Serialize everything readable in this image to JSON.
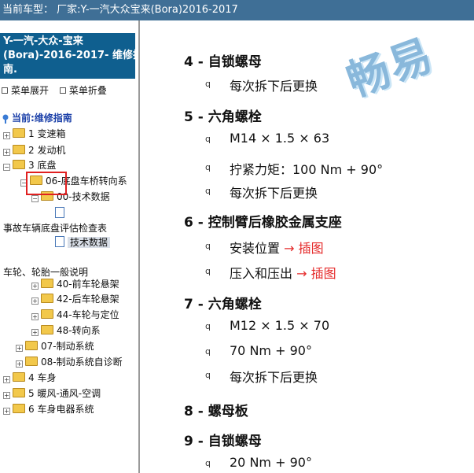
{
  "title": "当前车型：  厂家:Y-一汽大众宝来(Bora)2016-2017",
  "sidebar": {
    "header_lines": [
      "Y-一汽-大众-宝来",
      "(Bora)-2016-2017- 维修指",
      "南."
    ],
    "expand_label": "菜单展开",
    "collapse_label": "菜单折叠",
    "current_label": "当前:维修指南",
    "tree": [
      {
        "label": "1 变速箱",
        "type": "folder",
        "expander": "+"
      },
      {
        "label": "2 发动机",
        "type": "folder",
        "expander": "+"
      },
      {
        "label": "3 底盘",
        "type": "folder",
        "expander": "-",
        "highlighted": true
      },
      {
        "label": "06-底盘车桥转向系",
        "type": "folder",
        "expander": "-"
      },
      {
        "label": "00-技术数据",
        "type": "folder",
        "expander": "-"
      },
      {
        "label": "",
        "type": "doc"
      },
      {
        "label": "事故车辆底盘评估检查表",
        "type": "text"
      },
      {
        "label": "技术数据",
        "type": "doc",
        "selected": true
      },
      {
        "label": "车轮、轮胎一般说明",
        "type": "text"
      },
      {
        "label": "40-前车轮悬架",
        "type": "folder",
        "expander": "+"
      },
      {
        "label": "42-后车轮悬架",
        "type": "folder",
        "expander": "+"
      },
      {
        "label": "44-车轮与定位",
        "type": "folder",
        "expander": "+"
      },
      {
        "label": "48-转向系",
        "type": "folder",
        "expander": "+"
      },
      {
        "label": "07-制动系统",
        "type": "folder",
        "expander": "+"
      },
      {
        "label": "08-制动系统自诊断",
        "type": "folder",
        "expander": "+"
      },
      {
        "label": "4 车身",
        "type": "folder",
        "expander": "+"
      },
      {
        "label": "5 暖风-通风-空调",
        "type": "folder",
        "expander": "+"
      },
      {
        "label": "6 车身电器系统",
        "type": "folder",
        "expander": "+"
      }
    ]
  },
  "content": {
    "watermark": "畅易",
    "bullet_char": "q",
    "sections": [
      {
        "heading": "4 - 自锁螺母",
        "items": [
          {
            "text": "每次拆下后更换"
          }
        ]
      },
      {
        "heading": "5 - 六角螺栓",
        "items": [
          {
            "text": "M14 × 1.5 × 63"
          },
          {
            "text": "拧紧力矩：100 Nm + 90°"
          },
          {
            "text": "每次拆下后更换"
          }
        ]
      },
      {
        "heading": "6 - 控制臂后橡胶金属支座",
        "items": [
          {
            "text": "安装位置",
            "link": "→ 插图"
          },
          {
            "text": "压入和压出",
            "link": "→ 插图"
          }
        ]
      },
      {
        "heading": "7 - 六角螺栓",
        "items": [
          {
            "text": "M12 × 1.5 × 70"
          },
          {
            "text": "70 Nm + 90°"
          },
          {
            "text": "每次拆下后更换"
          }
        ]
      },
      {
        "heading": "8 - 螺母板",
        "items": []
      },
      {
        "heading": "9 - 自锁螺母",
        "items": [
          {
            "text": "20 Nm + 90°"
          }
        ]
      }
    ]
  }
}
